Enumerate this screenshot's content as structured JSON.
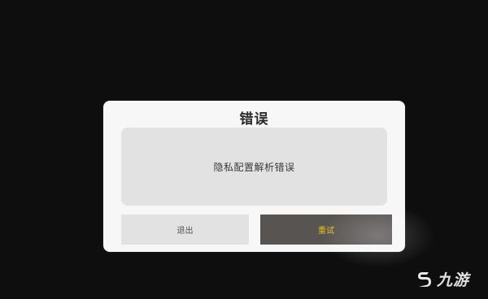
{
  "dialog": {
    "title": "错误",
    "message": "隐私配置解析错误",
    "exit_label": "退出",
    "retry_label": "重试"
  },
  "watermark": {
    "text": "九游",
    "logo_icon": "jiuyou-s-logo-icon"
  },
  "colors": {
    "background": "#0e0e0e",
    "dialog": "#f7f7f7",
    "panel": "#e2e2e2",
    "retry_button": "#575452",
    "retry_text": "#e8c21e"
  }
}
